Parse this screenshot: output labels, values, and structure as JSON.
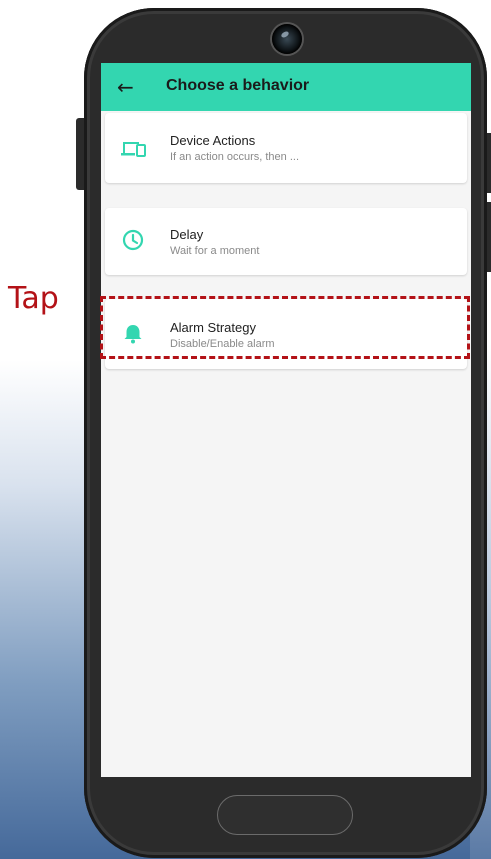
{
  "annotation": {
    "tap_label": "Tap"
  },
  "appbar": {
    "title": "Choose a behavior",
    "back_icon": "arrow-left-icon"
  },
  "cards": [
    {
      "title": "Device Actions",
      "subtitle": "If an action occurs, then ...",
      "icon": "devices-icon"
    },
    {
      "title": "Delay",
      "subtitle": "Wait for a moment",
      "icon": "clock-icon"
    },
    {
      "title": "Alarm Strategy",
      "subtitle": "Disable/Enable alarm",
      "icon": "bell-icon"
    }
  ],
  "colors": {
    "accent": "#33d6b0",
    "annotation": "#b31217"
  }
}
